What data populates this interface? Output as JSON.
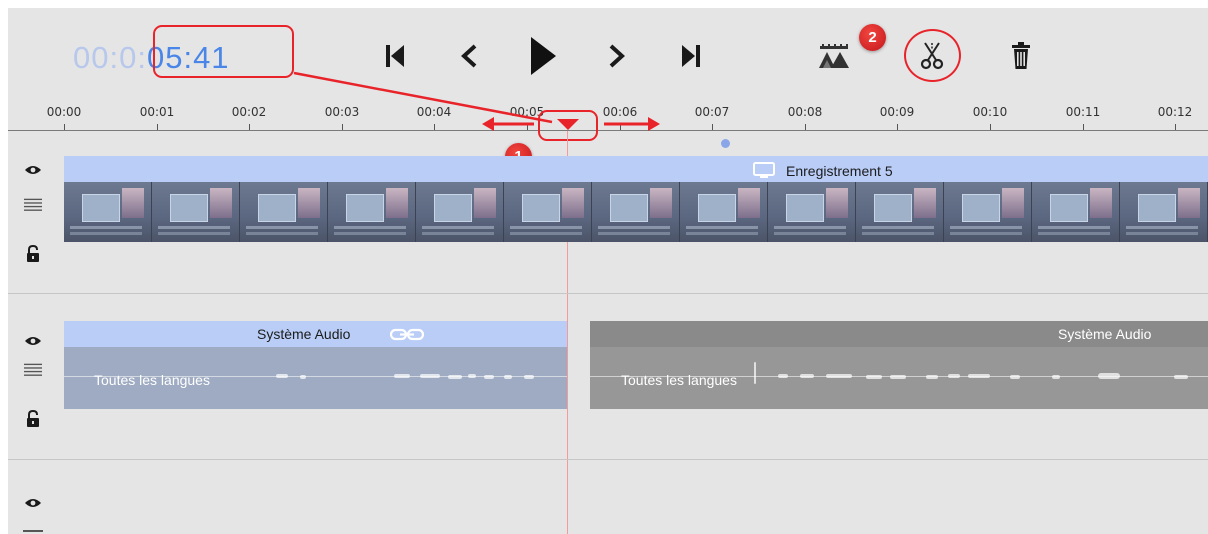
{
  "timecode": {
    "dim": "00:0",
    "dim2": ":",
    "value": "05:41"
  },
  "transport": {
    "first": "skip-to-start",
    "prev": "previous-frame",
    "play": "play",
    "next": "next-frame",
    "last": "skip-to-end"
  },
  "tools": [
    "mountains-marker-icon",
    "scissors-icon",
    "trash-icon"
  ],
  "callouts": {
    "playhead": "1",
    "split": "2"
  },
  "ruler": {
    "ticks": [
      "00:00",
      "00:01",
      "00:02",
      "00:03",
      "00:04",
      "00:05",
      "00:06",
      "00:07",
      "00:08",
      "00:09",
      "00:10",
      "00:11",
      "00:12"
    ]
  },
  "tracks": {
    "video": {
      "clip_title": "Enregistrement 5"
    },
    "audio": {
      "clip_a_title": "Système Audio",
      "clip_a_language": "Toutes les langues",
      "clip_b_title": "Système Audio",
      "clip_b_language": "Toutes les langues"
    }
  },
  "colors": {
    "accent": "#4a86e8",
    "callout": "#e8242a",
    "clip_selected": "#b9cdf7",
    "clip_unselected": "#8a8a8a"
  }
}
